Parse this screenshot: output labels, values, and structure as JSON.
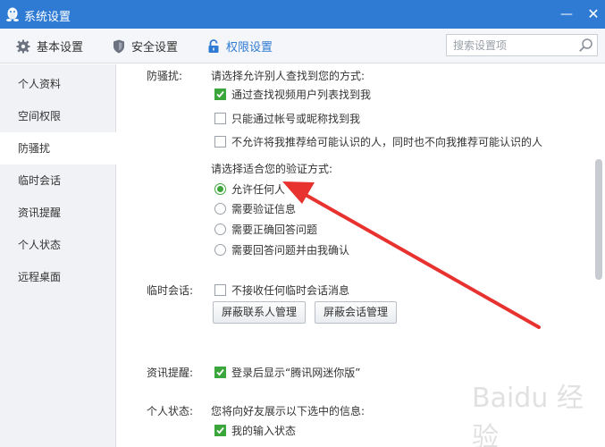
{
  "window": {
    "title": "系统设置",
    "minimize": "—",
    "close": "✕"
  },
  "tabs": [
    {
      "label": "基本设置",
      "icon": "gear-icon"
    },
    {
      "label": "安全设置",
      "icon": "shield-icon"
    },
    {
      "label": "权限设置",
      "icon": "lock-icon",
      "active": true
    }
  ],
  "search": {
    "placeholder": "搜索设置项"
  },
  "sidebar": {
    "items": [
      {
        "label": "个人资料"
      },
      {
        "label": "空间权限"
      },
      {
        "label": "防骚扰",
        "active": true
      },
      {
        "label": "临时会话"
      },
      {
        "label": "资讯提醒"
      },
      {
        "label": "个人状态"
      },
      {
        "label": "远程桌面"
      }
    ]
  },
  "anti_harass": {
    "label": "防骚扰:",
    "find_prompt": "请选择允许别人查找到您的方式:",
    "find_options": [
      {
        "label": "通过查找视频用户列表找到我",
        "checked": true
      },
      {
        "label": "只能通过帐号或昵称找到我",
        "checked": false
      },
      {
        "label": "不允许将我推荐给可能认识的人，同时也不向我推荐可能认识的人",
        "checked": false
      }
    ],
    "verify_prompt": "请选择适合您的验证方式:",
    "verify_options": [
      {
        "label": "允许任何人",
        "selected": true
      },
      {
        "label": "需要验证信息",
        "selected": false
      },
      {
        "label": "需要正确回答问题",
        "selected": false
      },
      {
        "label": "需要回答问题并由我确认",
        "selected": false
      }
    ]
  },
  "temp_session": {
    "label": "临时会话:",
    "option": {
      "label": "不接收任何临时会话消息",
      "checked": false
    },
    "btn_contacts": "屏蔽联系人管理",
    "btn_sessions": "屏蔽会话管理"
  },
  "news": {
    "label": "资讯提醒:",
    "option": {
      "label": "登录后显示“腾讯网迷你版”",
      "checked": true
    }
  },
  "status": {
    "label": "个人状态:",
    "prompt": "您将向好友展示以下选中的信息:",
    "option": {
      "label": "我的输入状态",
      "checked": true
    }
  },
  "colors": {
    "titlebar": "#2f7bd4",
    "check": "#3ba63b",
    "arrow": "#e8322f"
  },
  "watermark": "Baidu 经验"
}
